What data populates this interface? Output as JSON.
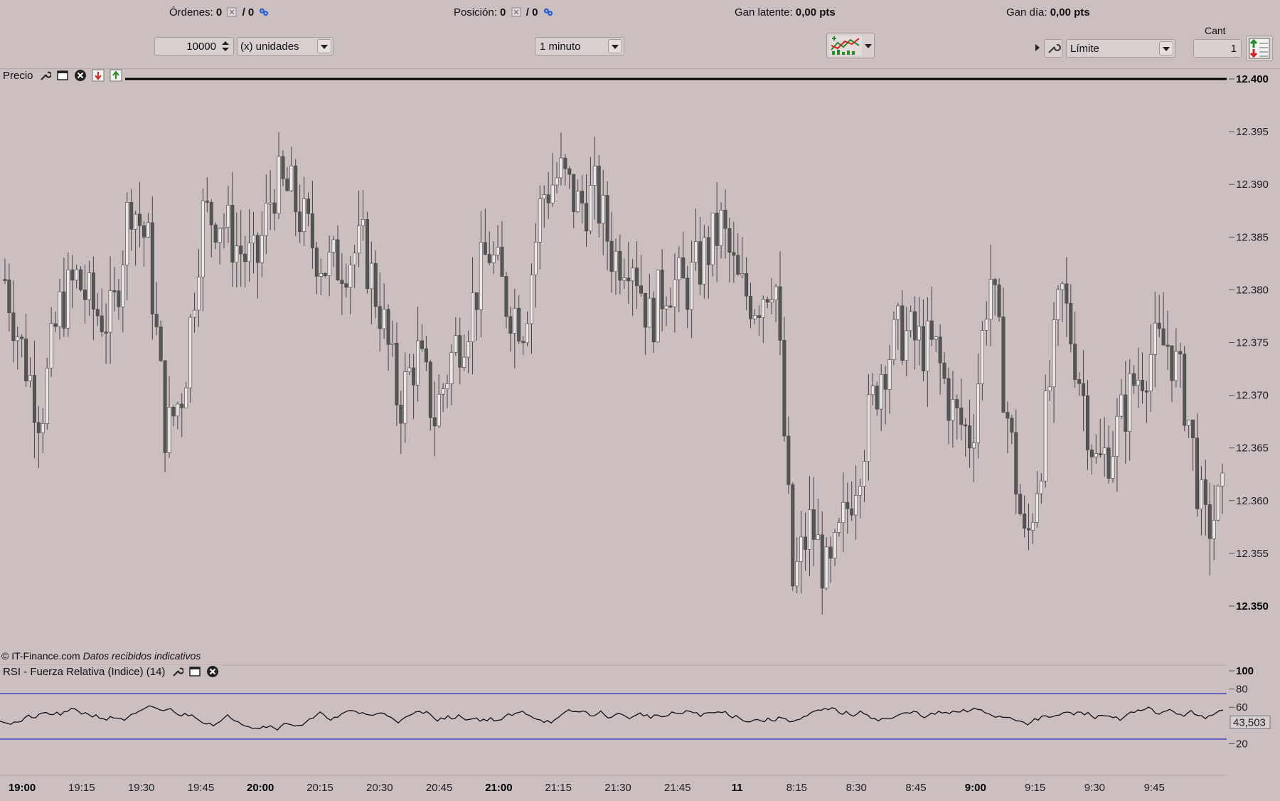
{
  "top_bar": {
    "orders_label": "Órdenes:",
    "orders_value": "0",
    "orders_sep": "/ 0",
    "position_label": "Posición:",
    "position_value": "0",
    "position_sep": "/ 0",
    "latent_label": "Gan latente:",
    "latent_value": "0,00 pts",
    "day_label": "Gan día:",
    "day_value": "0,00 pts"
  },
  "toolbar": {
    "quantity_value": "10000",
    "unit_label": "(x) unidades",
    "timeframe": "1 minuto",
    "order_type": "Límite",
    "cant_label": "Cant",
    "cant_value": "1"
  },
  "price_panel": {
    "label": "Precio",
    "watermark": "© IT-Finance.com",
    "watermark_note": "Datos recibidos indicativos"
  },
  "rsi_panel": {
    "label": "RSI - Fuerza Relativa (Indice) (14)",
    "current_value": "43,503"
  },
  "colors": {
    "background": "#cbbfbf",
    "bull_candle": "#ece6e6",
    "bear_candle": "#555555",
    "rsi_line": "#111111",
    "rsi_level_line": "#2a2ac8"
  },
  "chart_data": [
    {
      "type": "candlestick",
      "title": "Precio",
      "price_ticks": [
        "12.400",
        "12.395",
        "12.390",
        "12.385",
        "12.380",
        "12.375",
        "12.370",
        "12.365",
        "12.360",
        "12.355",
        "12.350"
      ],
      "bold_ticks": [
        "12.400",
        "12.350"
      ],
      "ylim": [
        12.35,
        12.4
      ],
      "time_ticks": [
        "19:00",
        "19:15",
        "19:30",
        "19:45",
        "20:00",
        "20:15",
        "20:30",
        "20:45",
        "21:00",
        "21:15",
        "21:30",
        "21:45",
        "11",
        "8:15",
        "8:30",
        "8:45",
        "9:00",
        "9:15",
        "9:30",
        "9:45"
      ],
      "bold_time_ticks": [
        "19:00",
        "20:00",
        "21:00",
        "11",
        "9:00"
      ],
      "series_closes_sampled": [
        12.381,
        12.374,
        12.368,
        12.378,
        12.381,
        12.378,
        12.377,
        12.389,
        12.384,
        12.366,
        12.371,
        12.387,
        12.387,
        12.384,
        12.382,
        12.39,
        12.389,
        12.385,
        12.382,
        12.383,
        12.384,
        12.378,
        12.369,
        12.374,
        12.368,
        12.374,
        12.378,
        12.384,
        12.379,
        12.377,
        12.389,
        12.391,
        12.388,
        12.389,
        12.383,
        12.384,
        12.377,
        12.381,
        12.38,
        12.383,
        12.386,
        12.38,
        12.379,
        12.382,
        12.352,
        12.358,
        12.352,
        12.359,
        12.366,
        12.373,
        12.376,
        12.375,
        12.374,
        12.368,
        12.366,
        12.382,
        12.368,
        12.355,
        12.366,
        12.38,
        12.372,
        12.363,
        12.366,
        12.371,
        12.374,
        12.375,
        12.369,
        12.357,
        12.36
      ]
    },
    {
      "type": "line",
      "title": "RSI - Fuerza Relativa (Indice) (14)",
      "y_ticks": [
        "100",
        "80",
        "60",
        "20"
      ],
      "levels": [
        75,
        25
      ],
      "ylim": [
        0,
        100
      ],
      "current": 43.503
    }
  ]
}
